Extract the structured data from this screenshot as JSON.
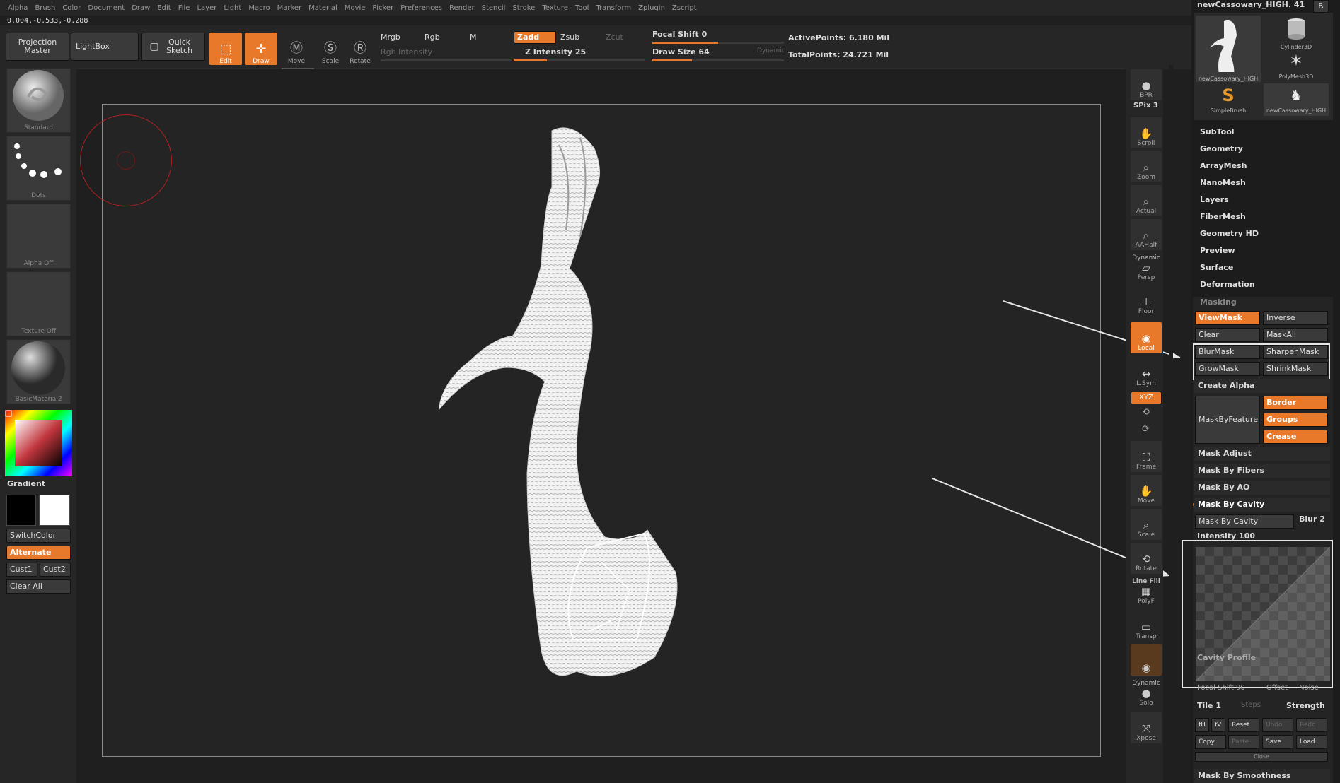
{
  "menu": [
    "Alpha",
    "Brush",
    "Color",
    "Document",
    "Draw",
    "Edit",
    "File",
    "Layer",
    "Light",
    "Macro",
    "Marker",
    "Material",
    "Movie",
    "Picker",
    "Preferences",
    "Render",
    "Stencil",
    "Stroke",
    "Texture",
    "Tool",
    "Transform",
    "Zplugin",
    "Zscript"
  ],
  "coords": "0.004,-0.533,-0.288",
  "top": {
    "projection_master": "Projection Master",
    "lightbox": "LightBox",
    "quick_sketch": "Quick Sketch",
    "edit": "Edit",
    "draw": "Draw",
    "move": "Move",
    "scale": "Scale",
    "rotate": "Rotate",
    "mrgb": "Mrgb",
    "rgb": "Rgb",
    "m": "M",
    "rgb_intensity": "Rgb Intensity",
    "zadd": "Zadd",
    "zsub": "Zsub",
    "zcut": "Zcut",
    "z_intensity": "Z Intensity 25",
    "z_intensity_value": 0.25,
    "focal_shift": "Focal Shift 0",
    "focal_shift_value": 0.5,
    "draw_size": "Draw Size 64",
    "draw_size_value": 0.3,
    "dynamic": "Dynamic",
    "active_points": "ActivePoints: 6.180  Mil",
    "total_points": "TotalPoints: 24.721  Mil"
  },
  "left": {
    "brush": "Standard",
    "stroke": "Dots",
    "alpha": "Alpha  Off",
    "texture": "Texture  Off",
    "material": "BasicMaterial2",
    "gradient": "Gradient",
    "switchcolor": "SwitchColor",
    "alternate": "Alternate",
    "cust1": "Cust1",
    "cust2": "Cust2",
    "clear_all": "Clear  All"
  },
  "right": {
    "bpr": "BPR",
    "spix": "SPix 3",
    "scroll": "Scroll",
    "zoom": "Zoom",
    "actual": "Actual",
    "aahalf": "AAHalf",
    "dynamic": "Dynamic",
    "persp": "Persp",
    "floor": "Floor",
    "local": "Local",
    "lsym": "L.Sym",
    "xyz": "XYZ",
    "frame": "Frame",
    "move": "Move",
    "scale": "Scale",
    "rotate": "Rotate",
    "linefill": "Line Fill",
    "polyf": "PolyF",
    "transp": "Transp",
    "dynamic2": "Dynamic",
    "solo": "Solo",
    "xpose": "Xpose"
  },
  "tray": {
    "tool_name": "newCassowary_HIGH. 41",
    "r": "R",
    "tools": [
      "newCassowary_HIGH",
      "Cylinder3D",
      "PolyMesh3D",
      "SimpleBrush",
      "newCassowary_HIGH"
    ],
    "sections": [
      "SubTool",
      "Geometry",
      "ArrayMesh",
      "NanoMesh",
      "Layers",
      "FiberMesh",
      "Geometry HD",
      "Preview",
      "Surface",
      "Deformation"
    ],
    "masking": "Masking",
    "viewmask": "ViewMask",
    "inverse": "Inverse",
    "clear": "Clear",
    "maskall": "MaskAll",
    "blurmask": "BlurMask",
    "sharpenmask": "SharpenMask",
    "growmask": "GrowMask",
    "shrinkmask": "ShrinkMask",
    "create_alpha": "Create  Alpha",
    "maskbyfeature": "MaskByFeature",
    "border": "Border",
    "groups": "Groups",
    "crease": "Crease",
    "mask_adjust": "Mask  Adjust",
    "mask_by_fibers": "Mask  By  Fibers",
    "mask_by_ao": "Mask  By  AO",
    "mask_by_cavity_title": "Mask  By  Cavity",
    "mask_by_cavity_btn": "Mask  By  Cavity",
    "blur": "Blur 2",
    "intensity": "Intensity 100",
    "cavity_profile": "Cavity  Profile",
    "focal_shift": "Focal Shift  90",
    "offset": "Offset",
    "noise": "Noise",
    "tile": "Tile 1",
    "steps": "Steps",
    "strength": "Strength",
    "fh": "fH",
    "fv": "fV",
    "reset": "Reset",
    "undo": "Undo",
    "redo": "Redo",
    "copy": "Copy",
    "paste": "Paste",
    "save": "Save",
    "load": "Load",
    "close": "Close",
    "mask_by_smoothness": "Mask  By  Smoothness"
  },
  "colors": {
    "accent": "#e8782a",
    "bg": "#1f1f1f",
    "panel": "#262626"
  }
}
